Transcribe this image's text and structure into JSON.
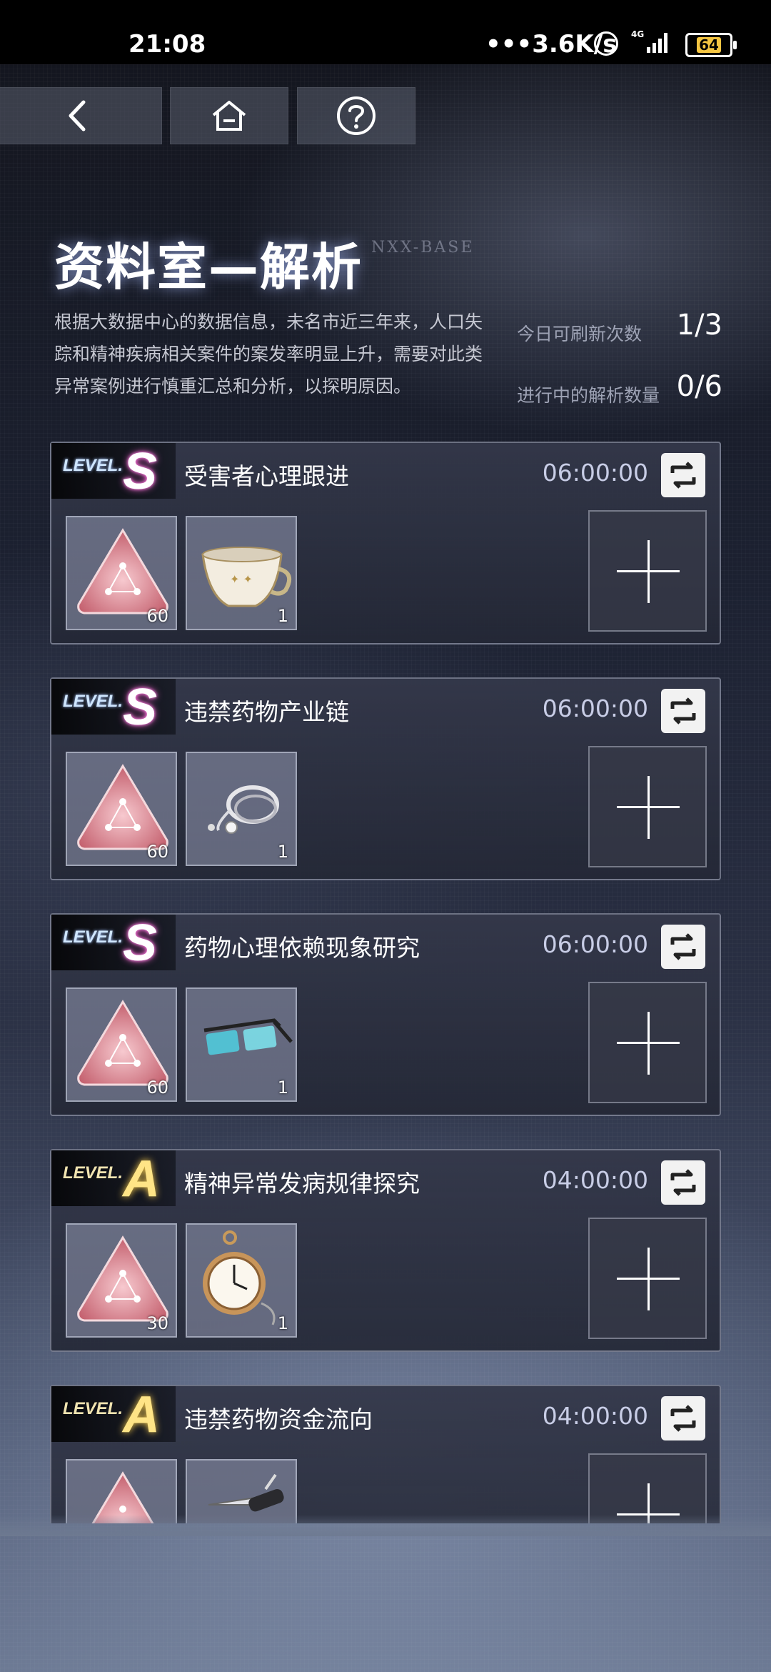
{
  "status_bar": {
    "time": "21:08",
    "network_speed": "•••3.6K/s",
    "signal": "4G",
    "battery": "64"
  },
  "nav": {
    "back_icon": "chevron-left-icon",
    "home_icon": "home-icon",
    "help_icon": "question-mark-icon"
  },
  "header": {
    "title": "资料室—解析",
    "subtitle": "NXX-BASE",
    "description": "根据大数据中心的数据信息，未名市近三年来，人口失踪和精神疾病相关案件的案发率明显上升，需要对此类异常案例进行慎重汇总和分析，以探明原因。"
  },
  "stats": {
    "refresh_label": "今日可刷新次数",
    "refresh_value": "1/3",
    "active_label": "进行中的解析数量",
    "active_value": "0/6"
  },
  "cards": [
    {
      "level_prefix": "LEVEL.",
      "grade": "S",
      "name": "受害者心理跟进",
      "timer": "06:00:00",
      "item1_count": "60",
      "item2_count": "1",
      "item2": "teacup"
    },
    {
      "level_prefix": "LEVEL.",
      "grade": "S",
      "name": "违禁药物产业链",
      "timer": "06:00:00",
      "item1_count": "60",
      "item2_count": "1",
      "item2": "stethoscope"
    },
    {
      "level_prefix": "LEVEL.",
      "grade": "S",
      "name": "药物心理依赖现象研究",
      "timer": "06:00:00",
      "item1_count": "60",
      "item2_count": "1",
      "item2": "glasses"
    },
    {
      "level_prefix": "LEVEL.",
      "grade": "A",
      "name": "精神异常发病规律探究",
      "timer": "04:00:00",
      "item1_count": "30",
      "item2_count": "1",
      "item2": "pocket-watch"
    },
    {
      "level_prefix": "LEVEL.",
      "grade": "A",
      "name": "违禁药物资金流向",
      "timer": "04:00:00",
      "item1_count": "",
      "item2_count": "",
      "item2": "pocket-knife"
    }
  ],
  "colors": {
    "grade_s_glow": "#ff66d6",
    "grade_a": "#ffe486",
    "card_border": "#aab0c3"
  }
}
